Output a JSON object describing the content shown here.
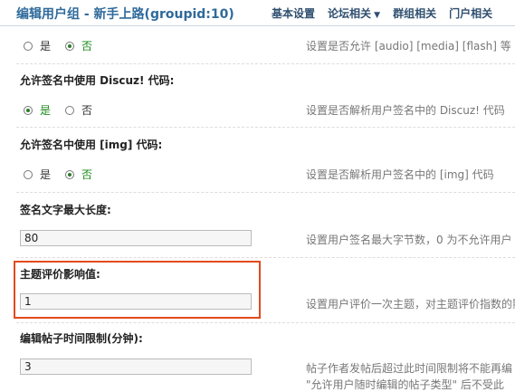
{
  "header": {
    "title": "编辑用户组 - 新手上路(groupid:10)",
    "tabs": [
      {
        "label": "基本设置"
      },
      {
        "label": "论坛相关",
        "dropdown": true
      },
      {
        "label": "群组相关"
      },
      {
        "label": "门户相关"
      }
    ]
  },
  "settings": [
    {
      "options": [
        "是",
        "否"
      ],
      "selected": "否",
      "description": "设置是否允许 [audio] [media] [flash] 等"
    },
    {
      "label": "允许签名中使用 Discuz! 代码:",
      "options": [
        "是",
        "否"
      ],
      "selected": "是",
      "description": "设置是否解析用户签名中的 Discuz! 代码"
    },
    {
      "label": "允许签名中使用 [img] 代码:",
      "options": [
        "是",
        "否"
      ],
      "selected": "否",
      "description": "设置是否解析用户签名中的 [img] 代码"
    },
    {
      "label": "签名文字最大长度:",
      "value": "80",
      "description": "设置用户签名最大字节数，0 为不允许用户"
    },
    {
      "label": "主题评价影响值:",
      "value": "1",
      "description": "设置用户评价一次主题，对主题评价指数的影"
    },
    {
      "label": "编辑帖子时间限制(分钟):",
      "value": "3",
      "description": "帖子作者发帖后超过此时间限制将不能再编",
      "description2": "\"允许用户随时编辑的帖子类型\" 后不受此"
    }
  ]
}
